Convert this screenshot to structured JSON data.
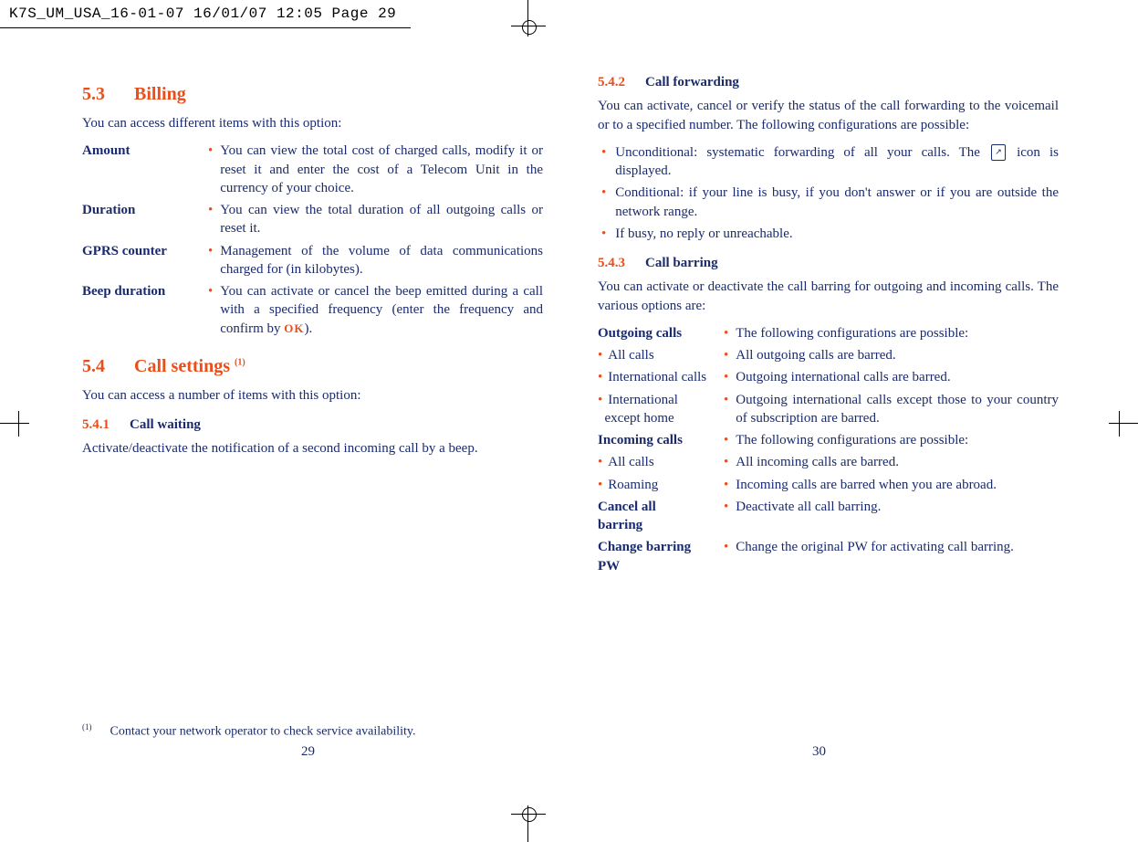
{
  "header": "K7S_UM_USA_16-01-07  16/01/07  12:05  Page 29",
  "left": {
    "s53_num": "5.3",
    "s53_title": "Billing",
    "s53_intro": "You can access different items with this option:",
    "amount_label": "Amount",
    "amount_text": "You can view the total cost of charged calls, modify it or reset it and enter the cost of a Telecom Unit in the currency of your choice.",
    "duration_label": "Duration",
    "duration_text": "You can view the total duration of all outgoing calls or reset it.",
    "gprs_label": "GPRS counter",
    "gprs_text": "Management of the volume of data communications charged for (in kilobytes).",
    "beep_label": "Beep duration",
    "beep_text_a": "You can activate or cancel the beep emitted during a call with a specified frequency (enter the frequency and confirm by ",
    "beep_ok": "OK",
    "beep_text_b": ").",
    "s54_num": "5.4",
    "s54_title": "Call settings ",
    "s54_sup": "(1)",
    "s54_intro": "You can access a number of items with this option:",
    "s541_num": "5.4.1",
    "s541_title": "Call waiting",
    "s541_text": "Activate/deactivate the notification of a second incoming call by a beep."
  },
  "right": {
    "s542_num": "5.4.2",
    "s542_title": "Call forwarding",
    "s542_intro": "You can activate, cancel or verify the status of the call forwarding to the voicemail or to a specified number. The following configurations are possible:",
    "fwd1a": "Unconditional: systematic forwarding of all your calls. The ",
    "fwd1b": " icon is displayed.",
    "fwd2": "Conditional: if your line is busy, if you don't answer or if you are outside the network range.",
    "fwd3": "If busy, no reply or unreachable.",
    "s543_num": "5.4.3",
    "s543_title": "Call barring",
    "s543_intro": "You can activate or deactivate the call barring for outgoing and incoming calls. The various options are:",
    "out_label": "Outgoing calls",
    "out_text": "The following configurations are possible:",
    "all_out_label": "All calls",
    "all_out_text": "All outgoing calls are barred.",
    "intl_label": "International calls",
    "intl_text": "Outgoing international calls are barred.",
    "intlex_label_a": "International",
    "intlex_label_b": "except home",
    "intlex_text": "Outgoing international calls except those to your country of subscription are barred.",
    "in_label": "Incoming calls",
    "in_text": "The following configurations are possible:",
    "all_in_label": "All calls",
    "all_in_text": "All incoming calls are barred.",
    "roam_label": "Roaming",
    "roam_text": "Incoming calls are barred when you are abroad.",
    "cancel_label_a": "Cancel all",
    "cancel_label_b": "barring",
    "cancel_text": "Deactivate all call barring.",
    "pw_label_a": "Change barring",
    "pw_label_b": "PW",
    "pw_text": "Change the original PW for activating call barring."
  },
  "footnote_sup": "(1)",
  "footnote_text": "Contact your network operator to check service availability.",
  "page_left": "29",
  "page_right": "30"
}
